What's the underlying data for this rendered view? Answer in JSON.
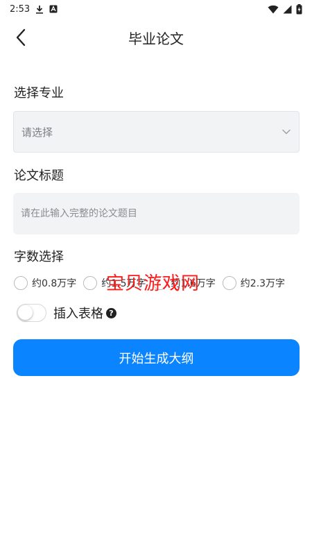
{
  "status_bar": {
    "time": "2:53",
    "left_icons": [
      "download-icon",
      "a-box-icon"
    ],
    "right_icons": [
      "wifi-icon",
      "cell-signal-icon",
      "battery-charging-icon"
    ]
  },
  "header": {
    "title": "毕业论文"
  },
  "major": {
    "label": "选择专业",
    "value": "请选择"
  },
  "thesis_title": {
    "label": "论文标题",
    "placeholder": "请在此输入完整的论文题目"
  },
  "word_count": {
    "label": "字数选择",
    "options": [
      "约0.8万字",
      "约1.5万字",
      "约1.6万字",
      "约2.3万字"
    ]
  },
  "insert_table": {
    "label": "插入表格",
    "enabled": false,
    "help": "?"
  },
  "generate_button": {
    "label": "开始生成大纲"
  },
  "watermark": {
    "text": "宝贝游戏网"
  },
  "colors": {
    "accent": "#0a84ff",
    "watermark": "#ff1a1a",
    "field_bg": "#f2f3f5"
  }
}
